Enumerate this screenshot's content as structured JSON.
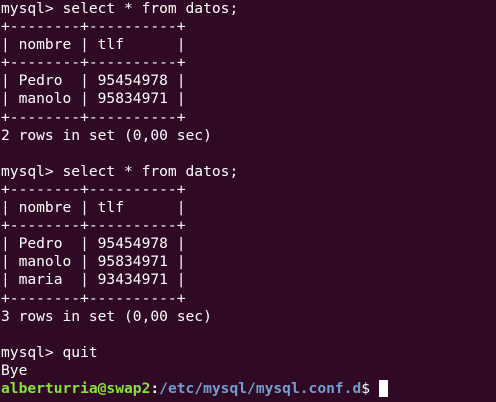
{
  "terminal": {
    "lines": [
      "mysql> select * from datos;",
      "+--------+----------+",
      "| nombre | tlf      |",
      "+--------+----------+",
      "| Pedro  | 95454978 |",
      "| manolo | 95834971 |",
      "+--------+----------+",
      "2 rows in set (0,00 sec)",
      "",
      "mysql> select * from datos;",
      "+--------+----------+",
      "| nombre | tlf      |",
      "+--------+----------+",
      "| Pedro  | 95454978 |",
      "| manolo | 95834971 |",
      "| maria  | 93434971 |",
      "+--------+----------+",
      "3 rows in set (0,00 sec)",
      "",
      "mysql> quit",
      "Bye"
    ],
    "prompt": {
      "user_host": "alberturria@swap2",
      "separator": ":",
      "path": "/etc/mysql/mysql.conf.d",
      "symbol": "$"
    }
  },
  "colors": {
    "background": "#300a24",
    "text": "#ffffff",
    "prompt_user": "#8ae234",
    "prompt_path": "#729fcf"
  }
}
